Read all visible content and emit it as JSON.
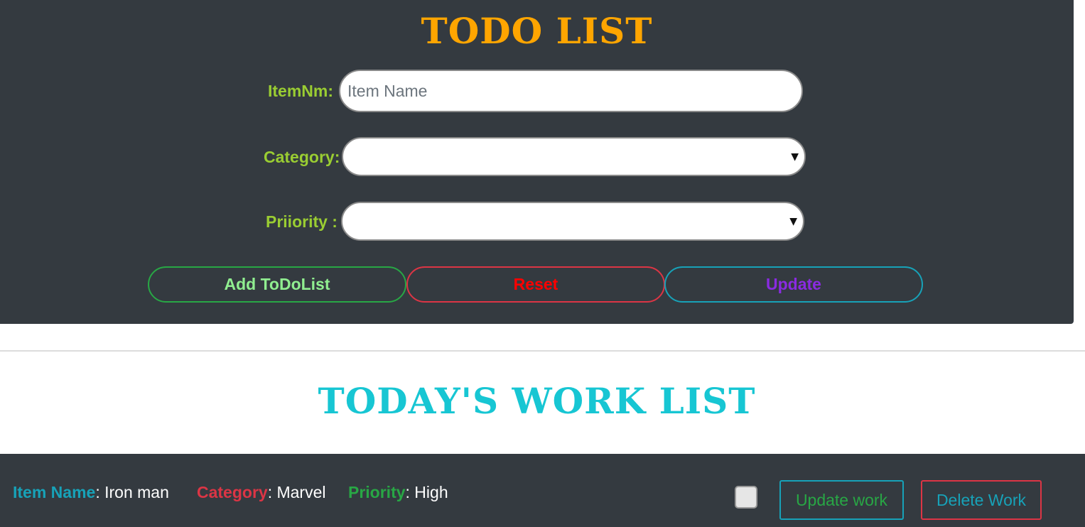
{
  "header": {
    "title": "TODO LIST"
  },
  "form": {
    "item_label": "ItemNm:",
    "item_placeholder": "Item Name",
    "item_value": "",
    "category_label": "Category:",
    "category_selected": "",
    "priority_label": "Priiority :",
    "priority_selected": ""
  },
  "buttons": {
    "add": "Add ToDoList",
    "reset": "Reset",
    "update": "Update"
  },
  "list": {
    "title": "TODAY'S WORK LIST",
    "items": [
      {
        "name_key": "Item Name",
        "name_value": ": Iron man",
        "category_key": "Category",
        "category_value": ": Marvel",
        "priority_key": "Priority",
        "priority_value": ": High",
        "done": false,
        "update_label": "Update work",
        "delete_label": "Delete Work"
      }
    ]
  },
  "icons": {
    "dropdown": "triangle-down-icon"
  },
  "colors": {
    "panel_bg": "#343a40",
    "title_orange": "#ffa500",
    "label_green": "#9acd32",
    "list_title_cyan": "#17c6d3",
    "add_green": "#90ee90",
    "reset_red": "#ff0000",
    "update_purple": "#8a2be2",
    "item_name_blue": "#17a2b8",
    "category_red": "#dc3545",
    "priority_green": "#28a745"
  }
}
